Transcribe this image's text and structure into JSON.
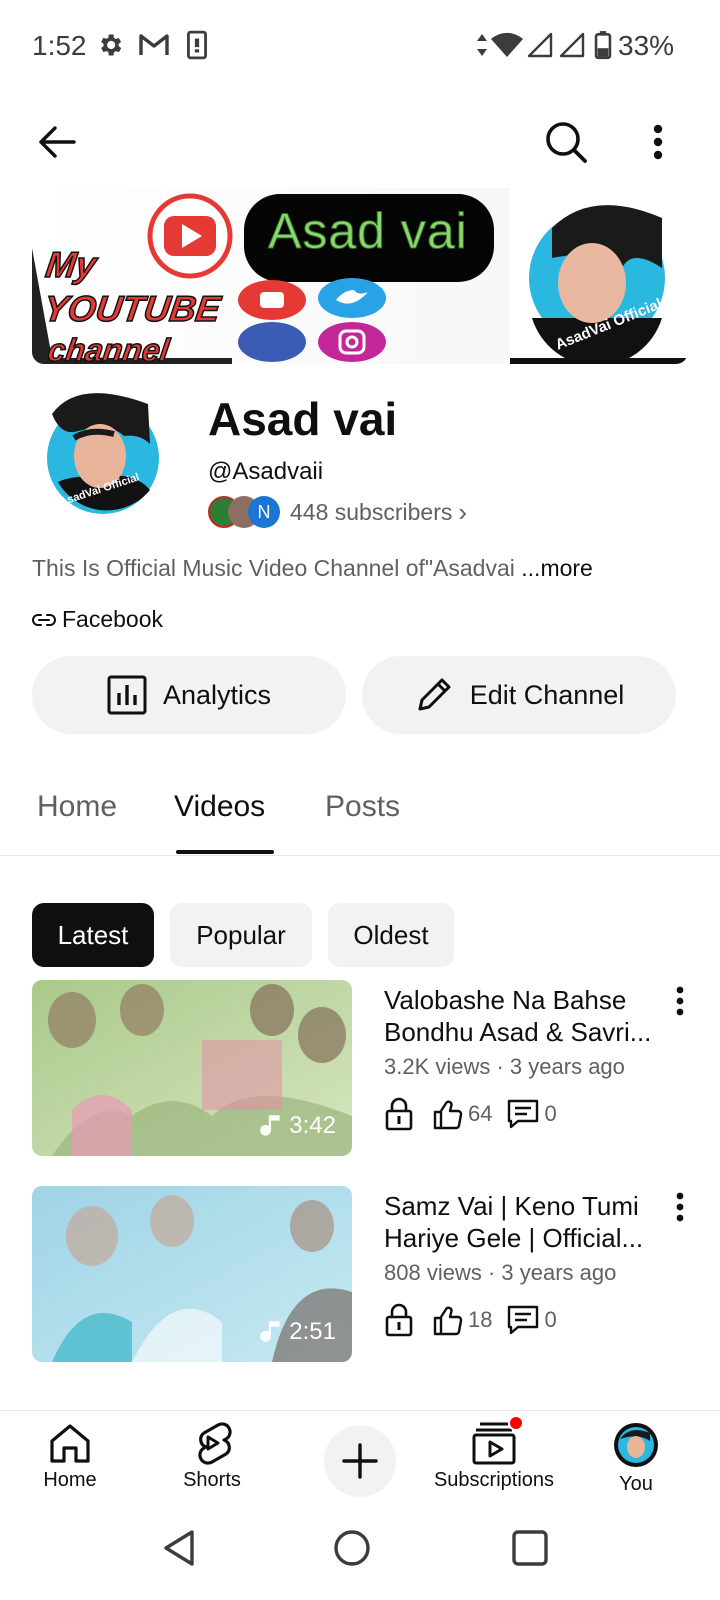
{
  "status_bar": {
    "time": "1:52",
    "battery": "33%",
    "icons": [
      "settings-icon",
      "gmail-icon",
      "sim-icon",
      "data-arrows-icon",
      "wifi-icon",
      "signal-icon",
      "signal-icon",
      "battery-icon"
    ]
  },
  "top_bar": {
    "icons": [
      "back-arrow-icon",
      "search-icon",
      "more-vert-icon"
    ]
  },
  "banner": {
    "my_text": "My",
    "youtube_text": "YOUTUBE",
    "channel_text": "channel",
    "name_text": "Asad vai",
    "official_text": "AsadVai Official"
  },
  "channel": {
    "title": "Asad vai",
    "handle": "@Asadvaii",
    "subscribers": "448 subscribers",
    "chevron": "›",
    "avatar_caption": "AsadVai Official",
    "subscriber_avatar_letter": "N",
    "description": "This Is Official Music Video Channel of\"Asadvai ",
    "more": "...more",
    "link_label": "Facebook"
  },
  "actions": {
    "analytics": "Analytics",
    "edit_channel": "Edit Channel"
  },
  "tabs": [
    "Home",
    "Videos",
    "Posts"
  ],
  "active_tab": "Videos",
  "chips": [
    "Latest",
    "Popular",
    "Oldest"
  ],
  "active_chip": "Latest",
  "videos": [
    {
      "title_line1": "Valobashe Na Bahse",
      "title_line2": "Bondhu Asad & Savri...",
      "meta": "3.2K views · 3 years ago",
      "duration": "3:42",
      "likes": "64",
      "comments": "0"
    },
    {
      "title_line1": "Samz Vai | Keno Tumi",
      "title_line2": "Hariye Gele  | Official...",
      "meta": "808 views · 3 years ago",
      "duration": "2:51",
      "likes": "18",
      "comments": "0"
    }
  ],
  "bottom_nav": {
    "home": "Home",
    "shorts": "Shorts",
    "subscriptions": "Subscriptions",
    "you": "You"
  },
  "colors": {
    "accent_red": "#ff0000",
    "text_primary": "#0f0f0f",
    "text_secondary": "#606060",
    "chip_bg": "#f2f2f2"
  }
}
